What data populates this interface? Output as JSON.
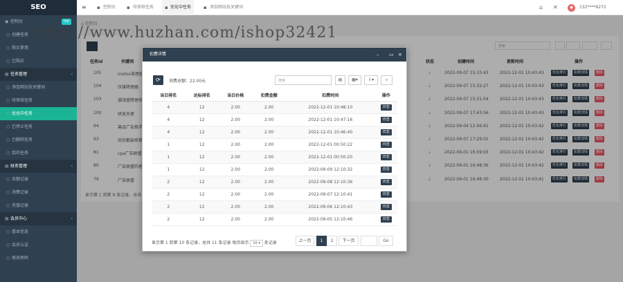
{
  "sidebar": {
    "logo": "SEO",
    "items": [
      {
        "label": "控制台",
        "icon": "dashboard-icon",
        "badge": "hot",
        "type": "top"
      },
      {
        "label": "创建任务",
        "type": "sub"
      },
      {
        "label": "购买使用",
        "type": "sub"
      },
      {
        "label": "已购买",
        "type": "sub"
      },
      {
        "label": "任务管理",
        "type": "parent"
      },
      {
        "label": "添加网站及关键词",
        "type": "sub"
      },
      {
        "label": "待审核任务",
        "type": "sub"
      },
      {
        "label": "优化中任务",
        "type": "active"
      },
      {
        "label": "已停止任务",
        "type": "sub"
      },
      {
        "label": "已删除任务",
        "type": "sub"
      },
      {
        "label": "我的任务",
        "type": "sub"
      },
      {
        "label": "财务管理",
        "type": "parent"
      },
      {
        "label": "余额记录",
        "type": "sub"
      },
      {
        "label": "消费记录",
        "type": "sub"
      },
      {
        "label": "充值记录",
        "type": "sub"
      },
      {
        "label": "会员中心",
        "type": "parent"
      },
      {
        "label": "基本信息",
        "type": "sub"
      },
      {
        "label": "会员认证",
        "type": "sub"
      },
      {
        "label": "修改密码",
        "type": "sub"
      }
    ]
  },
  "topbar": {
    "tabs": [
      "控制台",
      "待审核任务",
      "优化中任务",
      "添加网站及关键词"
    ],
    "user": "132****6272"
  },
  "breadcrumb": "控制台",
  "watermark": "https://www.huzhan.com/ishop32421",
  "background_table": {
    "search_placeholder": "搜索",
    "headers": [
      "任务id",
      "关键词",
      "状态",
      "创建时间",
      "更新时间",
      "操作"
    ],
    "rows": [
      {
        "id": "105",
        "kw": "motox准理器",
        "created": "2022-09-07 15:33:43",
        "updated": "2022-12-01 10:43:43"
      },
      {
        "id": "104",
        "kw": "压铸降理器",
        "created": "2022-09-07 15:32:27",
        "updated": "2022-12-01 10:43:43"
      },
      {
        "id": "103",
        "kw": "潮湾普降理电子",
        "created": "2022-09-07 15:31:54",
        "updated": "2022-12-01 10:43:43"
      },
      {
        "id": "100",
        "kw": "研发天使",
        "created": "2022-09-07 17:43:56",
        "updated": "2022-12-01 10:43:43"
      },
      {
        "id": "94",
        "kw": "幕品广告推手",
        "created": "2022-09-04 12:56:41",
        "updated": "2022-12-01 10:43:42"
      },
      {
        "id": "93",
        "kw": "尚优都装修推手",
        "created": "2022-09-07 17:29:01",
        "updated": "2022-12-01 10:43:42"
      },
      {
        "id": "81",
        "kw": "cpa广告联盟",
        "created": "2022-09-01 16:59:03",
        "updated": "2022-12-01 10:43:42"
      },
      {
        "id": "80",
        "kw": "广告联盟的理解",
        "created": "2022-09-01 16:48:36",
        "updated": "2022-12-01 10:43:42"
      },
      {
        "id": "79",
        "kw": "广告联盟",
        "created": "2022-09-01 16:48:30",
        "updated": "2022-12-01 10:43:41"
      }
    ],
    "btn_a": "优化排行",
    "btn_b": "扣费详情",
    "btn_c": "删除",
    "footer": "显示第 1 到第 9 条记录，总共"
  },
  "modal": {
    "title": "扣费详情",
    "total_label": "消费总额：22.00元",
    "search_placeholder": "搜索",
    "headers": [
      "当日排名",
      "达标排名",
      "当日价格",
      "扣费金额",
      "扣费时间",
      "操作"
    ],
    "rows": [
      {
        "rank": "4",
        "target": "12",
        "price": "2.00",
        "amount": "2.00",
        "time": "2022-12-01 10:48:10"
      },
      {
        "rank": "4",
        "target": "12",
        "price": "2.00",
        "amount": "2.00",
        "time": "2022-12-01 10:47:16"
      },
      {
        "rank": "4",
        "target": "12",
        "price": "2.00",
        "amount": "2.00",
        "time": "2022-12-01 10:46:40"
      },
      {
        "rank": "1",
        "target": "12",
        "price": "2.00",
        "amount": "2.00",
        "time": "2022-12-01 00:50:22"
      },
      {
        "rank": "1",
        "target": "12",
        "price": "2.00",
        "amount": "2.00",
        "time": "2022-12-01 00:50:20"
      },
      {
        "rank": "1",
        "target": "12",
        "price": "2.00",
        "amount": "2.00",
        "time": "2022-09-09 12:10:32"
      },
      {
        "rank": "2",
        "target": "12",
        "price": "2.00",
        "amount": "2.00",
        "time": "2022-09-08 12:10:36"
      },
      {
        "rank": "2",
        "target": "12",
        "price": "2.00",
        "amount": "2.00",
        "time": "2022-09-07 12:10:41"
      },
      {
        "rank": "2",
        "target": "12",
        "price": "2.00",
        "amount": "2.00",
        "time": "2022-09-06 12:10:43"
      },
      {
        "rank": "2",
        "target": "12",
        "price": "2.00",
        "amount": "2.00",
        "time": "2022-09-05 12:10:46"
      }
    ],
    "log_label": "日志",
    "footer_text": "显示第 1 到第 10 条记录，总共 11 条记录 每页显示",
    "page_size": "10",
    "footer_suffix": "条记录",
    "pagination": {
      "prev": "上一页",
      "pages": [
        "1",
        "2"
      ],
      "next": "下一页",
      "go": "Go"
    }
  }
}
